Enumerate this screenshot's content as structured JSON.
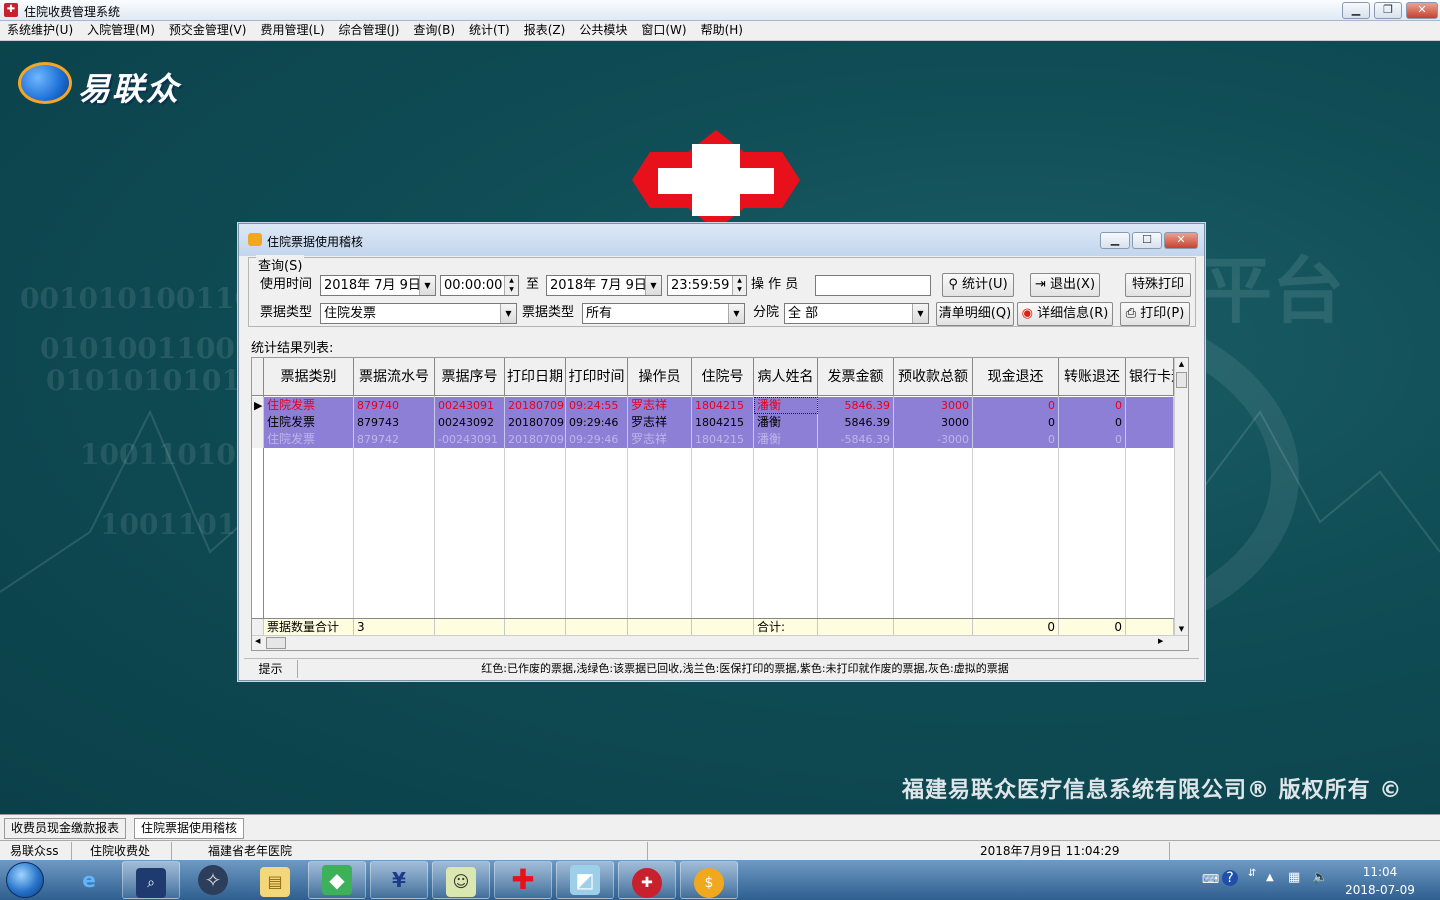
{
  "app": {
    "title": "住院收费管理系统"
  },
  "menu": [
    "系统维护(U)",
    "入院管理(M)",
    "预交金管理(V)",
    "费用管理(L)",
    "综合管理(J)",
    "查询(B)",
    "统计(T)",
    "报表(Z)",
    "公共模块",
    "窗口(W)",
    "帮助(H)"
  ],
  "desktop": {
    "logo_text": "易联众",
    "binary_1": "0010101001100",
    "binary_2": "01010011001",
    "binary_3": "0101010101",
    "binary_4": "10011010",
    "binary_5": "100110101",
    "watermark": "平台",
    "copyright": "福建易联众医疗信息系统有限公司® 版权所有 ©"
  },
  "dialog": {
    "title": "住院票据使用稽核",
    "query": {
      "legend": "查询(S)",
      "time_label": "使用时间",
      "date_from": "2018年 7月 9日",
      "time_from": "00:00:00",
      "to_label": "至",
      "date_to": "2018年 7月 9日",
      "time_to": "23:59:59",
      "operator_label": "操 作 员",
      "operator_value": "",
      "ticket_type_label": "票据类型",
      "ticket_type_value": "住院发票",
      "ticket_type2_label": "票据类型",
      "ticket_type2_value": "所有",
      "branch_label": "分院",
      "branch_value": "全 部"
    },
    "buttons": {
      "stat": "统计(U)",
      "exit": "退出(X)",
      "special_print": "特殊打印",
      "detail_list": "清单明细(Q)",
      "detail_info": "详细信息(R)",
      "print": "打印(P)"
    },
    "result_label": "统计结果列表:",
    "columns": [
      "票据类别",
      "票据流水号",
      "票据序号",
      "打印日期",
      "打印时间",
      "操作员",
      "住院号",
      "病人姓名",
      "发票金额",
      "预收款总额",
      "现金退还",
      "转账退还",
      "银行卡退"
    ],
    "rows": [
      [
        "住院发票",
        "879740",
        "00243091",
        "20180709",
        "09:24:55",
        "罗志祥",
        "1804215",
        "潘衡",
        "5846.39",
        "3000",
        "0",
        "0",
        ""
      ],
      [
        "住院发票",
        "879743",
        "00243092",
        "20180709",
        "09:29:46",
        "罗志祥",
        "1804215",
        "潘衡",
        "5846.39",
        "3000",
        "0",
        "0",
        ""
      ],
      [
        "住院发票",
        "879742",
        "-00243091",
        "20180709",
        "09:29:46",
        "罗志祥",
        "1804215",
        "潘衡",
        "-5846.39",
        "-3000",
        "0",
        "0",
        ""
      ]
    ],
    "summary": {
      "label": "票据数量合计",
      "count": "3",
      "total_label": "合计:",
      "cash_refund": "0",
      "transfer_refund": "0"
    },
    "status_label": "提示",
    "status_text": "红色:已作废的票据,浅绿色:该票据已回收,浅兰色:医保打印的票据,紫色:未打印就作废的票据,灰色:虚拟的票据"
  },
  "tabs": [
    "收费员现金缴款报表",
    "住院票据使用稽核"
  ],
  "statusbar": {
    "user": "易联众ss",
    "dept": "住院收费处",
    "hospital": "福建省老年医院",
    "datetime": "2018年7月9日 11:04:29"
  },
  "taskbar": {
    "time": "11:04",
    "date": "2018-07-09"
  },
  "colors": {
    "row_purple": "#8e7fd6",
    "row_red_text": "#e8001c",
    "row_gray_text": "#bdb6e6",
    "desktop": "#0e4a52"
  }
}
